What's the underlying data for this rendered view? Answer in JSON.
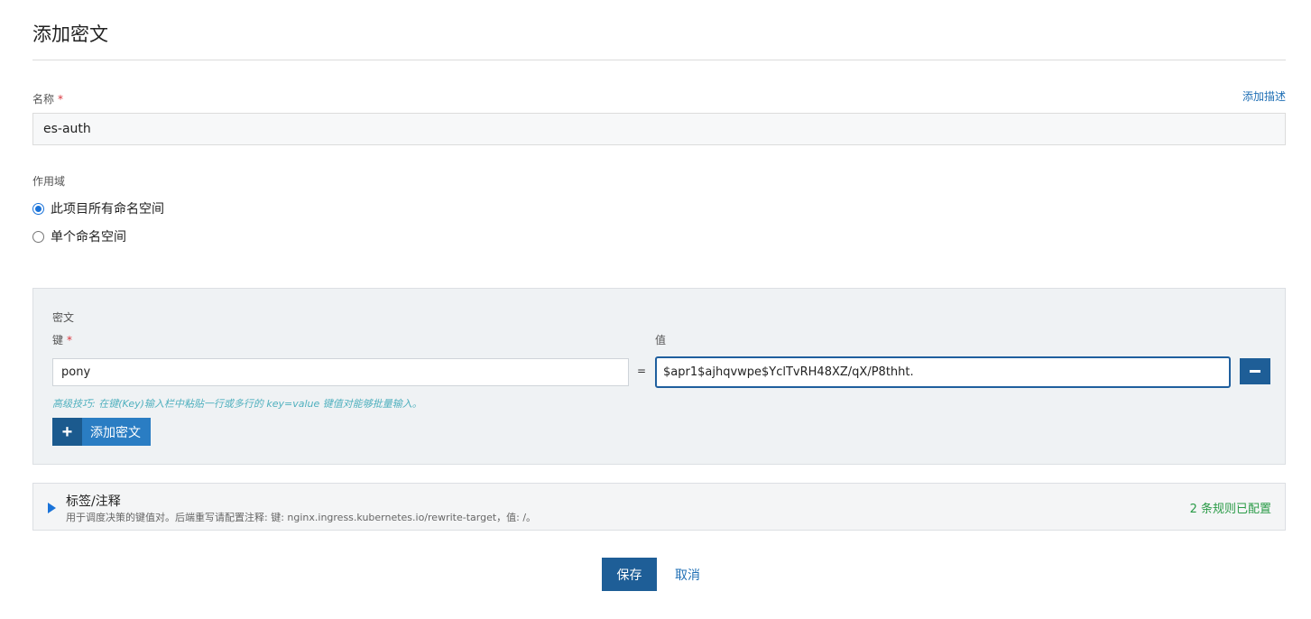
{
  "page": {
    "title": "添加密文"
  },
  "name_field": {
    "label": "名称",
    "required_mark": "*",
    "value": "es-auth",
    "add_description_link": "添加描述"
  },
  "scope": {
    "label": "作用域",
    "options": [
      {
        "label": "此项目所有命名空间",
        "selected": true
      },
      {
        "label": "单个命名空间",
        "selected": false
      }
    ]
  },
  "secret": {
    "title": "密文",
    "key_label": "键",
    "required_mark": "*",
    "value_label": "值",
    "entries": [
      {
        "key": "pony",
        "separator": "=",
        "value": "$apr1$ajhqvwpe$YclTvRH48XZ/qX/P8thht."
      }
    ],
    "tip": "高级技巧: 在键(Key)输入栏中粘贴一行或多行的 key=value 键值对能够批量输入。",
    "add_button_icon": "+",
    "add_button_label": "添加密文"
  },
  "labels_annotations": {
    "title": "标签/注释",
    "description": "用于调度决策的键值对。后端重写请配置注释: 键: nginx.ingress.kubernetes.io/rewrite-target，值: /。",
    "status": "2 条规则已配置",
    "status_color": "#2a9b47"
  },
  "actions": {
    "save_label": "保存",
    "cancel_label": "取消"
  },
  "colors": {
    "primary": "#1e5e97",
    "link": "#1f6fb5",
    "tip": "#4fb0be",
    "required": "#d9363e"
  }
}
